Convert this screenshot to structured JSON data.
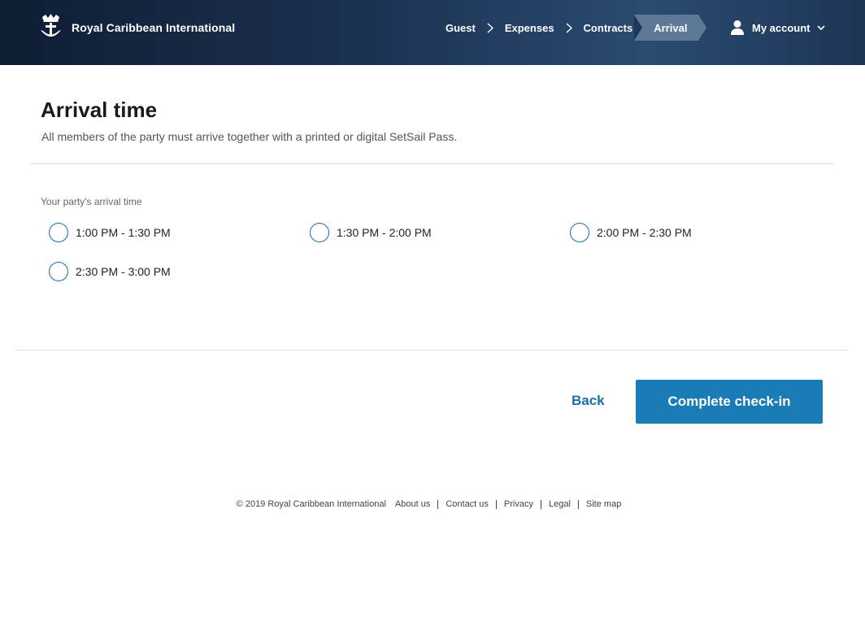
{
  "header": {
    "brand": "Royal Caribbean International",
    "steps": [
      "Guest",
      "Expenses",
      "Contracts"
    ],
    "active_step": "Arrival",
    "account_label": "My account"
  },
  "main": {
    "title": "Arrival time",
    "subtitle": "All members of the party must arrive together with a printed or digital SetSail Pass.",
    "field_label": "Your party's arrival time",
    "options": [
      "1:00 PM - 1:30 PM",
      "1:30 PM - 2:00 PM",
      "2:00 PM - 2:30 PM",
      "2:30 PM - 3:00 PM"
    ]
  },
  "actions": {
    "back_label": "Back",
    "complete_label": "Complete check-in"
  },
  "footer": {
    "copyright": "© 2019 Royal Caribbean International",
    "links": [
      "About us",
      "Contact us",
      "Privacy",
      "Legal",
      "Site map"
    ]
  },
  "colors": {
    "accent": "#1a7bb5",
    "header_dark": "#0f1d33",
    "step_active_bg": "#5e7897"
  }
}
